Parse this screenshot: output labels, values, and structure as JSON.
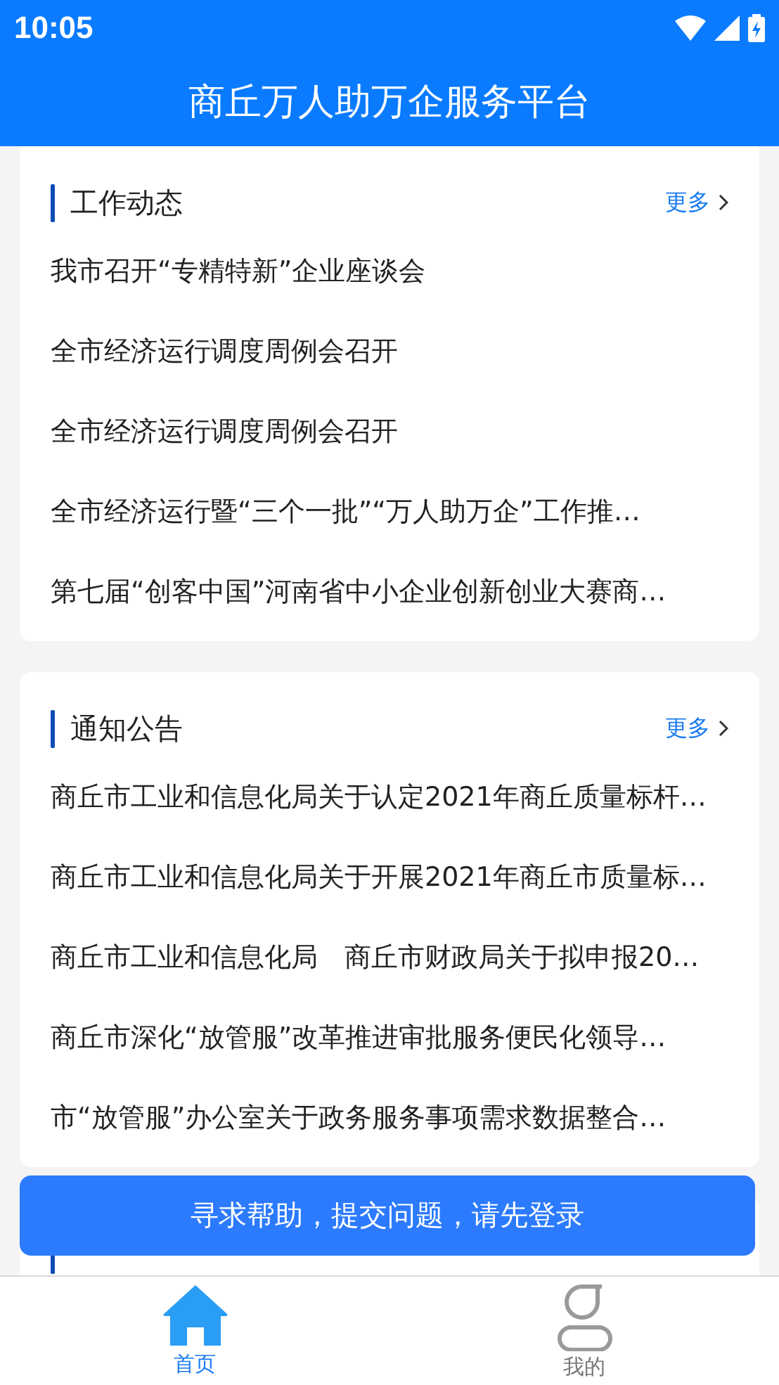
{
  "status_bar": {
    "time": "10:05"
  },
  "header": {
    "title": "商丘万人助万企服务平台"
  },
  "sections": [
    {
      "title": "工作动态",
      "more": "更多",
      "items": [
        "我市召开“专精特新”企业座谈会",
        "全市经济运行调度周例会召开",
        "全市经济运行调度周例会召开",
        "全市经济运行暨“三个一批”“万人助万企”工作推…",
        "第七届“创客中国”河南省中小企业创新创业大赛商…"
      ]
    },
    {
      "title": "通知公告",
      "more": "更多",
      "items": [
        "商丘市工业和信息化局关于认定2021年商丘质量标杆…",
        "商丘市工业和信息化局关于开展2021年商丘市质量标…",
        "商丘市工业和信息化局　商丘市财政局关于拟申报20…",
        "商丘市深化“放管服”改革推进审批服务便民化领导…",
        "市“放管服”办公室关于政务服务事项需求数据整合…"
      ]
    }
  ],
  "help_button": "寻求帮助，提交问题，请先登录",
  "tabs": [
    {
      "label": "首页",
      "kind": "home",
      "selected": true
    },
    {
      "label": "我的",
      "kind": "profile",
      "selected": false
    }
  ]
}
